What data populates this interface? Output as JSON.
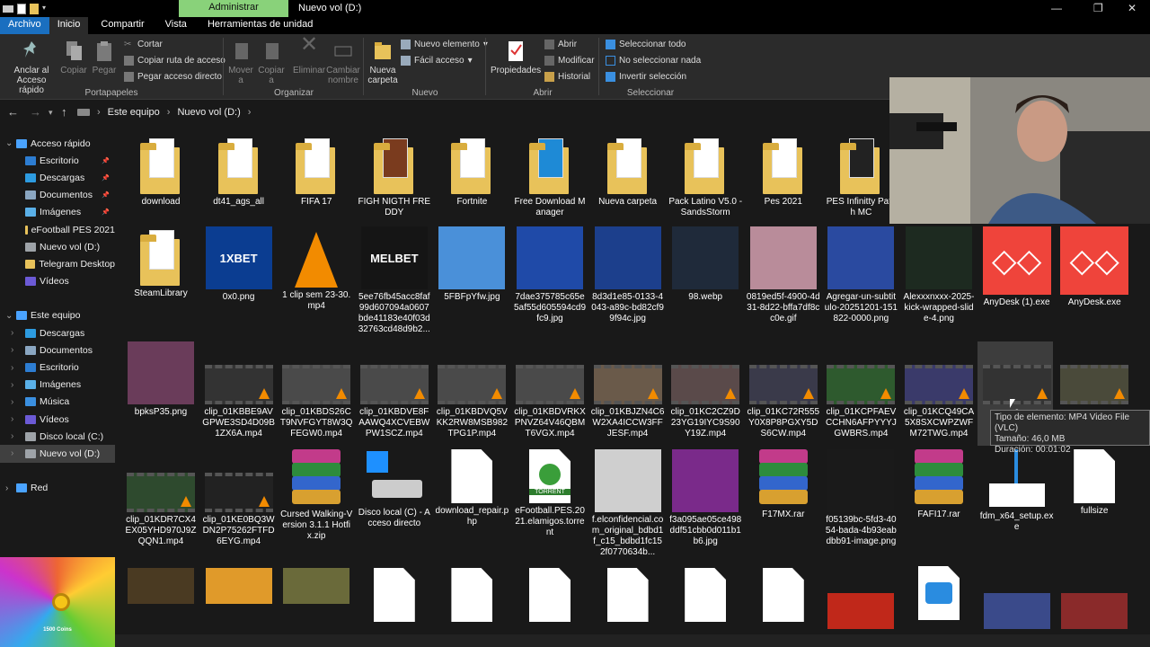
{
  "window": {
    "title": "Nuevo vol (D:)",
    "context_tab": "Administrar",
    "controls": {
      "minimize": "—",
      "maximize": "❐",
      "close": "✕"
    }
  },
  "tabs": [
    "Archivo",
    "Inicio",
    "Compartir",
    "Vista",
    "Herramientas de unidad"
  ],
  "ribbon": {
    "pin": "Anclar al\nAcceso rápido",
    "copy": "Copiar",
    "paste": "Pegar",
    "cut": "Cortar",
    "copy_path": "Copiar ruta de acceso",
    "paste_shortcut": "Pegar acceso directo",
    "group_clipboard": "Portapapeles",
    "move_to": "Mover\na",
    "copy_to": "Copiar\na",
    "delete": "Eliminar",
    "rename": "Cambiar\nnombre",
    "group_organize": "Organizar",
    "new_folder": "Nueva\ncarpeta",
    "new_item": "Nuevo elemento",
    "easy_access": "Fácil acceso",
    "group_new": "Nuevo",
    "properties": "Propiedades",
    "open": "Abrir",
    "edit": "Modificar",
    "history": "Historial",
    "group_open": "Abrir",
    "select_all": "Seleccionar todo",
    "select_none": "No seleccionar nada",
    "invert": "Invertir selección",
    "group_select": "Seleccionar"
  },
  "address": {
    "crumbs": [
      "Este equipo",
      "Nuevo vol (D:)"
    ]
  },
  "sidebar": [
    {
      "label": "Acceso rápido",
      "level": 0,
      "color": "#4aa3ff"
    },
    {
      "label": "Escritorio",
      "level": 1,
      "pin": true,
      "color": "#2d7dd2"
    },
    {
      "label": "Descargas",
      "level": 1,
      "pin": true,
      "color": "#2d9be0"
    },
    {
      "label": "Documentos",
      "level": 1,
      "pin": true,
      "color": "#8aa6c1"
    },
    {
      "label": "Imágenes",
      "level": 1,
      "pin": true,
      "color": "#5ab0e8"
    },
    {
      "label": "eFootball PES 2021",
      "level": 1,
      "color": "#e8c25a"
    },
    {
      "label": "Nuevo vol (D:)",
      "level": 1,
      "color": "#9ea3a8"
    },
    {
      "label": "Telegram Desktop",
      "level": 1,
      "color": "#e8c25a"
    },
    {
      "label": "Vídeos",
      "level": 1,
      "color": "#6c5ad6"
    },
    {
      "label": "",
      "level": -1
    },
    {
      "label": "Este equipo",
      "level": 0,
      "color": "#4aa3ff"
    },
    {
      "label": "Descargas",
      "level": 1,
      "color": "#2d9be0"
    },
    {
      "label": "Documentos",
      "level": 1,
      "color": "#8aa6c1"
    },
    {
      "label": "Escritorio",
      "level": 1,
      "color": "#2d7dd2"
    },
    {
      "label": "Imágenes",
      "level": 1,
      "color": "#5ab0e8"
    },
    {
      "label": "Música",
      "level": 1,
      "color": "#3a8fe0"
    },
    {
      "label": "Vídeos",
      "level": 1,
      "color": "#6c5ad6"
    },
    {
      "label": "Disco local (C:)",
      "level": 1,
      "color": "#9ea3a8"
    },
    {
      "label": "Nuevo vol (D:)",
      "level": 1,
      "selected": true,
      "color": "#9ea3a8"
    },
    {
      "label": "",
      "level": -1
    },
    {
      "label": "Red",
      "level": 0,
      "color": "#4aa3ff"
    }
  ],
  "files": [
    {
      "name": "download",
      "kind": "folder",
      "col": 0,
      "row": 0
    },
    {
      "name": "dt41_ags_all",
      "kind": "folder",
      "col": 1,
      "row": 0
    },
    {
      "name": "FIFA 17",
      "kind": "folder",
      "col": 2,
      "row": 0
    },
    {
      "name": "FIGH NIGTH FREDDY",
      "kind": "folder-img",
      "col": 3,
      "row": 0,
      "color": "#7a3b1e"
    },
    {
      "name": "Fortnite",
      "kind": "folder",
      "col": 4,
      "row": 0
    },
    {
      "name": "Free Download Manager",
      "kind": "folder-img",
      "col": 5,
      "row": 0,
      "color": "#1e8ad6"
    },
    {
      "name": "Nueva carpeta",
      "kind": "folder",
      "col": 6,
      "row": 0
    },
    {
      "name": "Pack Latino V5.0 - SandsStorm",
      "kind": "folder",
      "col": 7,
      "row": 0
    },
    {
      "name": "Pes 2021",
      "kind": "folder",
      "col": 8,
      "row": 0
    },
    {
      "name": "PES Infinitty Patch MC",
      "kind": "folder-img",
      "col": 9,
      "row": 0,
      "color": "#222222"
    },
    {
      "name": "SteamLibrary",
      "kind": "folder",
      "col": 0,
      "row": 1
    },
    {
      "name": "0x0.png",
      "kind": "image",
      "col": 1,
      "row": 1,
      "color": "#0b3d91",
      "text": "1XBET"
    },
    {
      "name": "1 clip sem 23-30.mp4",
      "kind": "vlc",
      "col": 2,
      "row": 1
    },
    {
      "name": "5ee76fb45acc8faf99d607094a0607bde41183e40f03d32763cd48d9b2...",
      "kind": "image",
      "col": 3,
      "row": 1,
      "color": "#151515",
      "text": "MELBET"
    },
    {
      "name": "5FBFpYfw.jpg",
      "kind": "image",
      "col": 4,
      "row": 1,
      "color": "#4a90d9"
    },
    {
      "name": "7dae375785c65e5af55d605594cd9fc9.jpg",
      "kind": "image",
      "col": 5,
      "row": 1,
      "color": "#1f4aa8"
    },
    {
      "name": "8d3d1e85-0133-4043-a89c-bd82cf99f94c.jpg",
      "kind": "image",
      "col": 6,
      "row": 1,
      "color": "#1c3f8c"
    },
    {
      "name": "98.webp",
      "kind": "image",
      "col": 7,
      "row": 1,
      "color": "#1f2a3a"
    },
    {
      "name": "0819ed5f-4900-4d31-8d22-bffa7df8cc0e.gif",
      "kind": "image",
      "col": 8,
      "row": 1,
      "color": "#b98c9a"
    },
    {
      "name": "Agregar-un-subtitulo-20251201-151822-0000.png",
      "kind": "image",
      "col": 9,
      "row": 1,
      "color": "#2a4aa0"
    },
    {
      "name": "Alexxxnxxx-2025-kick-wrapped-slide-4.png",
      "kind": "image",
      "col": 10,
      "row": 1,
      "color": "#1d2a20"
    },
    {
      "name": "AnyDesk (1).exe",
      "kind": "anydesk",
      "col": 11,
      "row": 1
    },
    {
      "name": "AnyDesk.exe",
      "kind": "anydesk",
      "col": 12,
      "row": 1
    },
    {
      "name": "bpksP35.png",
      "kind": "image",
      "col": 0,
      "row": 2,
      "color": "#6a3c5a"
    },
    {
      "name": "clip_01KBBE9AVGPWE3SD4D09B1ZX6A.mp4",
      "kind": "video",
      "col": 1,
      "row": 2,
      "color": "#333333"
    },
    {
      "name": "clip_01KBDS26CT9NVFGYT8W3QFEGW0.mp4",
      "kind": "video",
      "col": 2,
      "row": 2,
      "color": "#4a4a4a"
    },
    {
      "name": "clip_01KBDVE8FAAWQ4XCVEBWPW1SCZ.mp4",
      "kind": "video",
      "col": 3,
      "row": 2,
      "color": "#4a4a4a"
    },
    {
      "name": "clip_01KBDVQ5VKK2RW8MSB982TPG1P.mp4",
      "kind": "video",
      "col": 4,
      "row": 2,
      "color": "#4a4a4a"
    },
    {
      "name": "clip_01KBDVRKXPNVZ64V46QBMT6VGX.mp4",
      "kind": "video",
      "col": 5,
      "row": 2,
      "color": "#4a4a4a"
    },
    {
      "name": "clip_01KBJZN4C6W2XA4ICCW3FFJESF.mp4",
      "kind": "video",
      "col": 6,
      "row": 2,
      "color": "#6a5a4a"
    },
    {
      "name": "clip_01KC2CZ9D23YG19IYC9S90Y19Z.mp4",
      "kind": "video",
      "col": 7,
      "row": 2,
      "color": "#5a4a4a"
    },
    {
      "name": "clip_01KC72R555Y0X8P8PGXY5DS6CW.mp4",
      "kind": "video",
      "col": 8,
      "row": 2,
      "color": "#3a3a4a"
    },
    {
      "name": "clip_01KCPFAEVCCHN6AFPYYYJGWBRS.mp4",
      "kind": "video",
      "col": 9,
      "row": 2,
      "color": "#2e5a2e"
    },
    {
      "name": "clip_01KCQ49CA5X8SXCWPZWFM72TWG.mp4",
      "kind": "video",
      "col": 10,
      "row": 2,
      "color": "#3a3a6a"
    },
    {
      "name": "c",
      "kind": "video",
      "col": 11,
      "row": 2,
      "color": "#333333"
    },
    {
      "name": "",
      "kind": "video",
      "col": 12,
      "row": 2,
      "color": "#4a4a3a"
    },
    {
      "name": "clip_01KDR7CX4EX05YHD970J9ZQQN1.mp4",
      "kind": "video",
      "col": 0,
      "row": 3,
      "color": "#2e4a2e"
    },
    {
      "name": "clip_01KE0BQ3WDN2P75262FTFD6EYG.mp4",
      "kind": "video",
      "col": 1,
      "row": 3,
      "color": "#222222"
    },
    {
      "name": "Cursed Walking-Version 3.1.1 Hotfix.zip",
      "kind": "rar",
      "col": 2,
      "row": 3
    },
    {
      "name": "Disco local (C) - Acceso directo",
      "kind": "drive",
      "col": 3,
      "row": 3
    },
    {
      "name": "download_repair.php",
      "kind": "doc",
      "col": 4,
      "row": 3
    },
    {
      "name": "eFootball.PES.2021.elamigos.torrent",
      "kind": "torrent",
      "col": 5,
      "row": 3
    },
    {
      "name": "f.elconfidencial.com_original_bdbd1f_c15_bdbd1fc152f0770634b...",
      "kind": "image",
      "col": 6,
      "row": 3,
      "color": "#cfcfcf"
    },
    {
      "name": "f3a095ae05ce498ddf51cbb0d011b1b6.jpg",
      "kind": "image",
      "col": 7,
      "row": 3,
      "color": "#7a2a8a"
    },
    {
      "name": "F17MX.rar",
      "kind": "rar",
      "col": 8,
      "row": 3
    },
    {
      "name": "f05139bc-5fd3-4054-bada-4b93eabdbb91-image.png",
      "kind": "image",
      "col": 9,
      "row": 3,
      "color": "#1a1a1a"
    },
    {
      "name": "FAFI17.rar",
      "kind": "rar",
      "col": 10,
      "row": 3
    },
    {
      "name": "fdm_x64_setup.exe",
      "kind": "installer",
      "col": 11,
      "row": 3
    },
    {
      "name": "fullsize",
      "kind": "doc",
      "col": 12,
      "row": 3
    },
    {
      "name": "",
      "kind": "image",
      "col": 0,
      "row": 4,
      "color": "#4a3a22"
    },
    {
      "name": "",
      "kind": "image",
      "col": 1,
      "row": 4,
      "color": "#e09a2a"
    },
    {
      "name": "",
      "kind": "image",
      "col": 2,
      "row": 4,
      "color": "#6a6a3a"
    },
    {
      "name": "",
      "kind": "doc",
      "col": 3,
      "row": 4
    },
    {
      "name": "",
      "kind": "doc",
      "col": 4,
      "row": 4
    },
    {
      "name": "",
      "kind": "doc",
      "col": 5,
      "row": 4
    },
    {
      "name": "",
      "kind": "doc",
      "col": 6,
      "row": 4
    },
    {
      "name": "",
      "kind": "doc",
      "col": 7,
      "row": 4
    },
    {
      "name": "",
      "kind": "doc",
      "col": 8,
      "row": 4
    },
    {
      "name": "",
      "kind": "image",
      "col": 9,
      "row": 4,
      "color": "#c0281a"
    },
    {
      "name": "",
      "kind": "photo-doc",
      "col": 10,
      "row": 4
    },
    {
      "name": "",
      "kind": "image",
      "col": 11,
      "row": 4,
      "color": "#3a4a8a"
    },
    {
      "name": "",
      "kind": "image",
      "col": 12,
      "row": 4,
      "color": "#8a2a2a"
    }
  ],
  "tooltip": [
    "Tipo de elemento: MP4 Video File (VLC)",
    "Tamaño: 46,0 MB",
    "Duración: 00:01:02"
  ],
  "overlay_badge": "1500 Coins"
}
